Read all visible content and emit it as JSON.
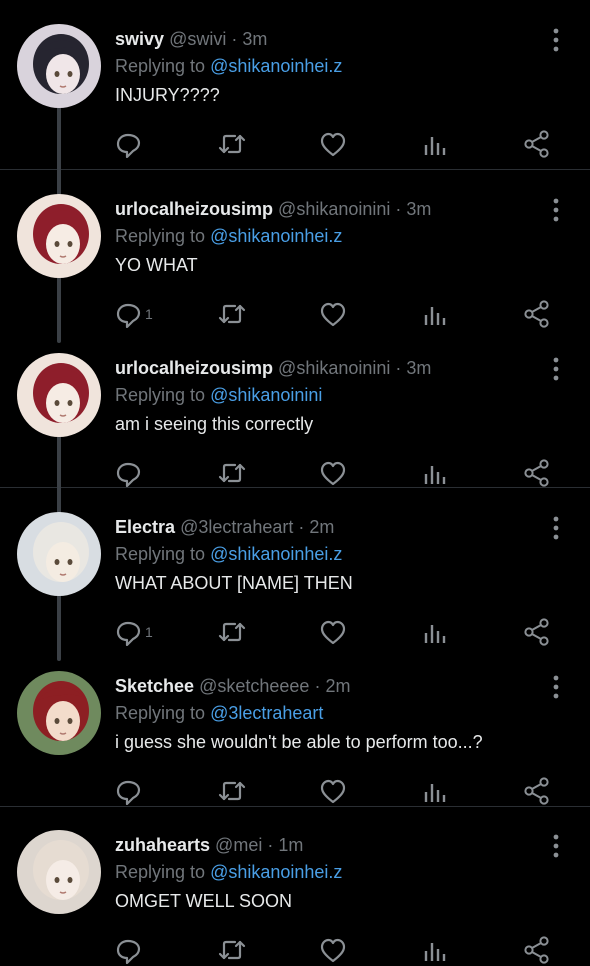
{
  "tweets": [
    {
      "name": "swivy",
      "handle": "@swivi",
      "sep": "·",
      "time": "3m",
      "replying_label": "Replying to",
      "replying_to": "@shikanoinhei.z",
      "text": "INJURY????",
      "reply_count": "",
      "avatar_colors": [
        "#d9d3dc",
        "#262530",
        "#f0e6e8"
      ]
    },
    {
      "name": "urlocalheizousimp",
      "handle": "@shikanoinini",
      "sep": "·",
      "time": "3m",
      "replying_label": "Replying to",
      "replying_to": "@shikanoinhei.z",
      "text": "YO WHAT",
      "reply_count": "1",
      "avatar_colors": [
        "#f0e4dc",
        "#8e1e2b",
        "#f6ece4"
      ]
    },
    {
      "name": "urlocalheizousimp",
      "handle": "@shikanoinini",
      "sep": "·",
      "time": "3m",
      "replying_label": "Replying to",
      "replying_to": "@shikanoinini",
      "text": "am i seeing this correctly",
      "reply_count": "",
      "avatar_colors": [
        "#f0e4dc",
        "#8e1e2b",
        "#f6ece4"
      ]
    },
    {
      "name": "Electra",
      "handle": "@3lectraheart",
      "sep": "·",
      "time": "2m",
      "replying_label": "Replying to",
      "replying_to": "@shikanoinhei.z",
      "text": "WHAT ABOUT [NAME] THEN",
      "reply_count": "1",
      "avatar_colors": [
        "#d8dde2",
        "#e9e7e2",
        "#f4ece2"
      ]
    },
    {
      "name": "Sketchee",
      "handle": "@sketcheeee",
      "sep": "·",
      "time": "2m",
      "replying_label": "Replying to",
      "replying_to": "@3lectraheart",
      "text": "i guess she wouldn't be able to perform too...?",
      "reply_count": "",
      "avatar_colors": [
        "#6f8a5e",
        "#8d1f23",
        "#f3dccb"
      ]
    },
    {
      "name": "zuhahearts",
      "handle": "@mei",
      "sep": "·",
      "time": "1m",
      "replying_label": "Replying to",
      "replying_to": "@shikanoinhei.z",
      "text": "OMGET WELL SOON",
      "reply_count": "",
      "avatar_colors": [
        "#ddd6cf",
        "#e6dcd2",
        "#f5ece6"
      ]
    }
  ],
  "icons": {
    "reply": "reply-icon",
    "retweet": "retweet-icon",
    "like": "like-icon",
    "views": "views-icon",
    "share": "share-icon",
    "more": "more-icon"
  },
  "colors": {
    "background": "#000000",
    "text": "#e7e9ea",
    "muted": "#71767b",
    "link": "#4a9fe6",
    "divider": "#2a2e33"
  }
}
